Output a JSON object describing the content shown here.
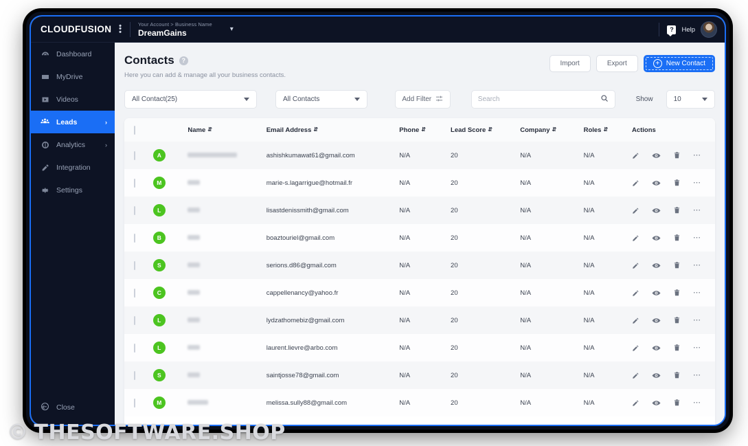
{
  "brand": {
    "name": "CLOUDFUSION",
    "kebab_icon": "kebab-menu-icon"
  },
  "header": {
    "breadcrumb": "Your Account > Business Name",
    "business_name": "DreamGains",
    "caret_icon": "chevron-down-icon",
    "help_label": "Help",
    "help_icon": "help-question-icon",
    "avatar_icon": "user-avatar"
  },
  "sidebar": {
    "items": [
      {
        "label": "Dashboard",
        "icon": "dashboard-icon",
        "active": false,
        "chevron": false
      },
      {
        "label": "MyDrive",
        "icon": "drive-icon",
        "active": false,
        "chevron": false
      },
      {
        "label": "Videos",
        "icon": "video-icon",
        "active": false,
        "chevron": false
      },
      {
        "label": "Leads",
        "icon": "leads-users-icon",
        "active": true,
        "chevron": true
      },
      {
        "label": "Analytics",
        "icon": "analytics-icon",
        "active": false,
        "chevron": true
      },
      {
        "label": "Integration",
        "icon": "integration-icon",
        "active": false,
        "chevron": false
      },
      {
        "label": "Settings",
        "icon": "gear-icon",
        "active": false,
        "chevron": false
      }
    ],
    "close": {
      "label": "Close",
      "icon": "arrow-left-circle-icon"
    }
  },
  "page": {
    "title": "Contacts",
    "help_icon": "question-mark-icon",
    "subtitle": "Here you can add & manage all your business contacts."
  },
  "actions": {
    "import_label": "Import",
    "export_label": "Export",
    "new_contact_label": "New Contact",
    "new_contact_icon": "plus-circle-icon"
  },
  "filters": {
    "contact_set": "All Contact(25)",
    "contact_type": "All Contacts",
    "add_filter_label": "Add Filter",
    "add_filter_icon": "sliders-icon",
    "search_placeholder": "Search",
    "search_value": "",
    "search_icon": "search-icon",
    "show_label": "Show",
    "show_value": "10"
  },
  "table": {
    "columns": [
      {
        "label": "",
        "sortable": false
      },
      {
        "label": "",
        "sortable": false
      },
      {
        "label": "Name",
        "sortable": true
      },
      {
        "label": "Email Address",
        "sortable": true
      },
      {
        "label": "Phone",
        "sortable": true
      },
      {
        "label": "Lead Score",
        "sortable": true
      },
      {
        "label": "Company",
        "sortable": true
      },
      {
        "label": "Roles",
        "sortable": true
      },
      {
        "label": "Actions",
        "sortable": false
      }
    ],
    "row_action_icons": [
      "edit-pencil-icon",
      "view-eye-icon",
      "delete-trash-icon",
      "more-options-icon"
    ],
    "rows": [
      {
        "initial": "A",
        "name": "",
        "name_redacted": true,
        "name_width": 72,
        "email": "ashishkumawat61@gmail.com",
        "phone": "N/A",
        "lead_score": "20",
        "company": "N/A",
        "roles": "N/A"
      },
      {
        "initial": "M",
        "name": "",
        "name_redacted": true,
        "name_width": 18,
        "email": "marie-s.lagarrigue@hotmail.fr",
        "phone": "N/A",
        "lead_score": "20",
        "company": "N/A",
        "roles": "N/A"
      },
      {
        "initial": "L",
        "name": "",
        "name_redacted": true,
        "name_width": 18,
        "email": "lisastdenissmith@gmail.com",
        "phone": "N/A",
        "lead_score": "20",
        "company": "N/A",
        "roles": "N/A"
      },
      {
        "initial": "B",
        "name": "",
        "name_redacted": true,
        "name_width": 18,
        "email": "boaztouriel@gmail.com",
        "phone": "N/A",
        "lead_score": "20",
        "company": "N/A",
        "roles": "N/A"
      },
      {
        "initial": "S",
        "name": "",
        "name_redacted": true,
        "name_width": 18,
        "email": "serions.d86@gmail.com",
        "phone": "N/A",
        "lead_score": "20",
        "company": "N/A",
        "roles": "N/A"
      },
      {
        "initial": "C",
        "name": "",
        "name_redacted": true,
        "name_width": 18,
        "email": "cappellenancy@yahoo.fr",
        "phone": "N/A",
        "lead_score": "20",
        "company": "N/A",
        "roles": "N/A"
      },
      {
        "initial": "L",
        "name": "",
        "name_redacted": true,
        "name_width": 18,
        "email": "lydzathomebiz@gmail.com",
        "phone": "N/A",
        "lead_score": "20",
        "company": "N/A",
        "roles": "N/A"
      },
      {
        "initial": "L",
        "name": "",
        "name_redacted": true,
        "name_width": 18,
        "email": "laurent.lievre@arbo.com",
        "phone": "N/A",
        "lead_score": "20",
        "company": "N/A",
        "roles": "N/A"
      },
      {
        "initial": "S",
        "name": "",
        "name_redacted": true,
        "name_width": 18,
        "email": "saintjosse78@gmail.com",
        "phone": "N/A",
        "lead_score": "20",
        "company": "N/A",
        "roles": "N/A"
      },
      {
        "initial": "M",
        "name": "",
        "name_redacted": true,
        "name_width": 30,
        "email": "melissa.sully88@gmail.com",
        "phone": "N/A",
        "lead_score": "20",
        "company": "N/A",
        "roles": "N/A"
      }
    ]
  },
  "watermark": {
    "symbol": "©",
    "text": "THESOFTWARE.SHOP"
  },
  "colors": {
    "accent_blue": "#1a6ef5",
    "avatar_green": "#4cc420",
    "sidebar_dark": "#0d1324"
  }
}
